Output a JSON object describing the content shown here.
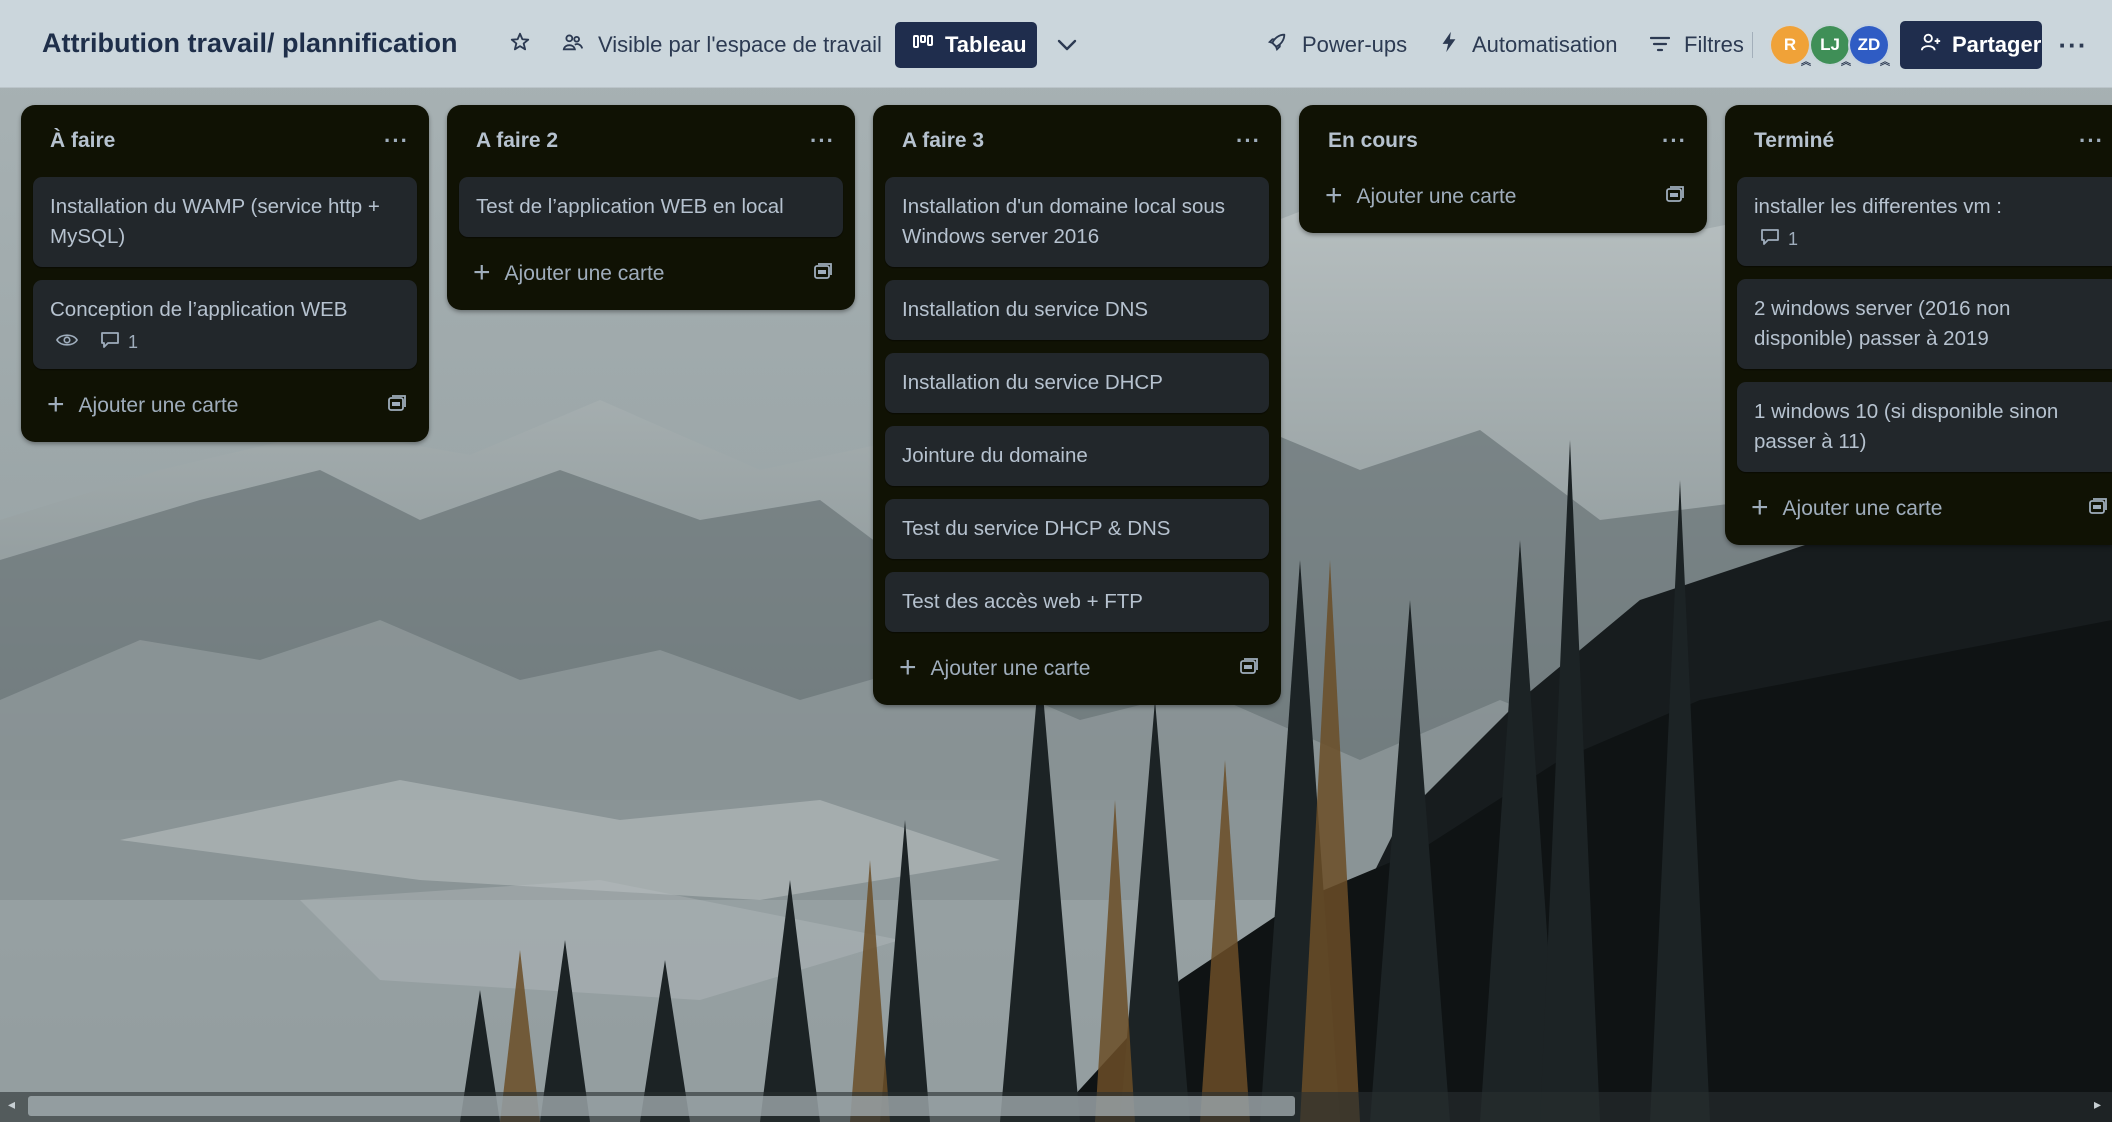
{
  "header": {
    "board_title": "Attribution travail/ plannification",
    "visibility_label": "Visible par l'espace de travail",
    "view_label": "Tableau",
    "powerups_label": "Power-ups",
    "automation_label": "Automatisation",
    "filters_label": "Filtres",
    "share_label": "Partager",
    "members": [
      {
        "initials": "R",
        "color": "#f0a238"
      },
      {
        "initials": "LJ",
        "color": "#3f8f57"
      },
      {
        "initials": "ZD",
        "color": "#2f5cc4"
      }
    ]
  },
  "lists": [
    {
      "title": "À faire",
      "cards": [
        {
          "text": "Installation du WAMP (service http + MySQL)"
        },
        {
          "text": "Conception de l’application WEB",
          "watching": true,
          "comments": "1"
        }
      ],
      "add_label": "Ajouter une carte"
    },
    {
      "title": "A faire 2",
      "cards": [
        {
          "text": "Test de l’application WEB en local"
        }
      ],
      "add_label": "Ajouter une carte"
    },
    {
      "title": "A faire 3",
      "cards": [
        {
          "text": "Installation d'un domaine local sous Windows server 2016"
        },
        {
          "text": "Installation du service DNS"
        },
        {
          "text": "Installation du service DHCP"
        },
        {
          "text": "Jointure du domaine"
        },
        {
          "text": "Test du service DHCP & DNS"
        },
        {
          "text": "Test des accès web + FTP"
        }
      ],
      "add_label": "Ajouter une carte"
    },
    {
      "title": "En cours",
      "cards": [],
      "add_label": "Ajouter une carte"
    },
    {
      "title": "Terminé",
      "cards": [
        {
          "text": "installer les differentes vm :",
          "comments": "1"
        },
        {
          "text": "2 windows server (2016 non disponible) passer à 2019"
        },
        {
          "text": "1 windows 10 (si disponible sinon passer à 11)"
        }
      ],
      "add_label": "Ajouter une carte"
    }
  ],
  "colors": {
    "list_bg": "#101204",
    "card_bg": "#22272b",
    "text": "#b6c2cf",
    "header_bg": "#ced8df",
    "primary_button": "#1f2d4d"
  },
  "icons": [
    "star-icon",
    "workspace-visibility-icon",
    "board-view-icon",
    "chevron-down-icon",
    "rocket-icon",
    "lightning-icon",
    "filter-icon",
    "add-person-icon",
    "more-icon",
    "plus-icon",
    "template-icon",
    "eye-icon",
    "comment-icon"
  ]
}
